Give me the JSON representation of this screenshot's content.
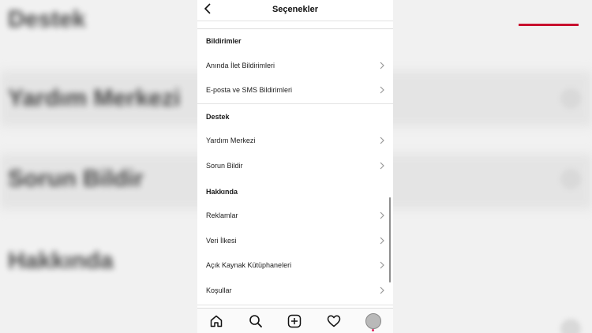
{
  "header": {
    "title": "Seçenekler"
  },
  "sections": [
    {
      "heading": "Bildirimler",
      "items": [
        {
          "label": "Anında İlet Bildirimleri"
        },
        {
          "label": "E-posta ve SMS Bildirimleri"
        }
      ]
    },
    {
      "heading": "Destek",
      "items": [
        {
          "label": "Yardım Merkezi"
        },
        {
          "label": "Sorun Bildir"
        }
      ]
    },
    {
      "heading": "Hakkında",
      "items": [
        {
          "label": "Reklamlar"
        },
        {
          "label": "Veri İlkesi"
        },
        {
          "label": "Açık Kaynak Kütüphaneleri"
        },
        {
          "label": "Koşullar"
        }
      ]
    }
  ],
  "tabbar": {
    "icons": [
      "home-icon",
      "search-icon",
      "add-icon",
      "heart-icon",
      "profile-avatar"
    ]
  },
  "background": {
    "blurred_texts": [
      "Destek",
      "Yardım Merkezi",
      "Sorun Bildir",
      "Hakkında"
    ]
  },
  "colors": {
    "accent_line": "#c8102e",
    "notification_dot": "#e0245e"
  }
}
